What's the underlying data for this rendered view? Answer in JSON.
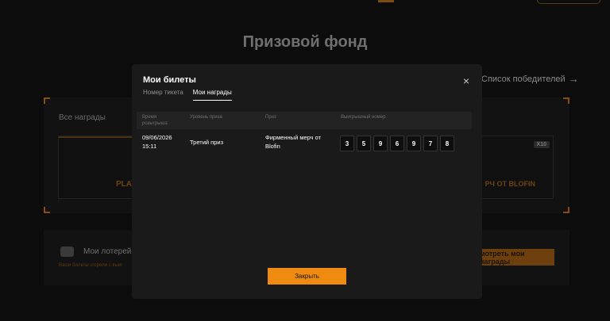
{
  "background": {
    "page_title": "Призовой фонд",
    "winners_link": "Список победителей",
    "all_rewards": "Все награды",
    "card_left_text": "PLAY",
    "card_right_text": "РЧ ОТ BLOFIN",
    "card_badge": "X10",
    "lottery_title": "Мои лотерейн",
    "lottery_subtitle": "Ваши билеты сгорели с выиг",
    "my_rewards_button": "мотреть мои награды"
  },
  "modal": {
    "title": "Мои билеты",
    "close_label": "×",
    "tabs": [
      {
        "label": "Номер тикета",
        "active": false
      },
      {
        "label": "Мои награды",
        "active": true
      }
    ],
    "columns": {
      "time": "Время розыгрыша",
      "level": "Уровень приза",
      "prize": "Приз",
      "number": "Выигрышный номер"
    },
    "rows": [
      {
        "date": "09/06/2026",
        "time": "15:11",
        "level": "Третий приз",
        "prize_line1": "Фирменный мерч от",
        "prize_line2": "Blofin",
        "digits": [
          "3",
          "5",
          "9",
          "6",
          "9",
          "7",
          "8"
        ]
      }
    ],
    "confirm_button": "Закрыть"
  },
  "colors": {
    "accent": "#f08b12",
    "modal_bg": "#1a1a1a",
    "page_bg": "#0c0c0c"
  }
}
